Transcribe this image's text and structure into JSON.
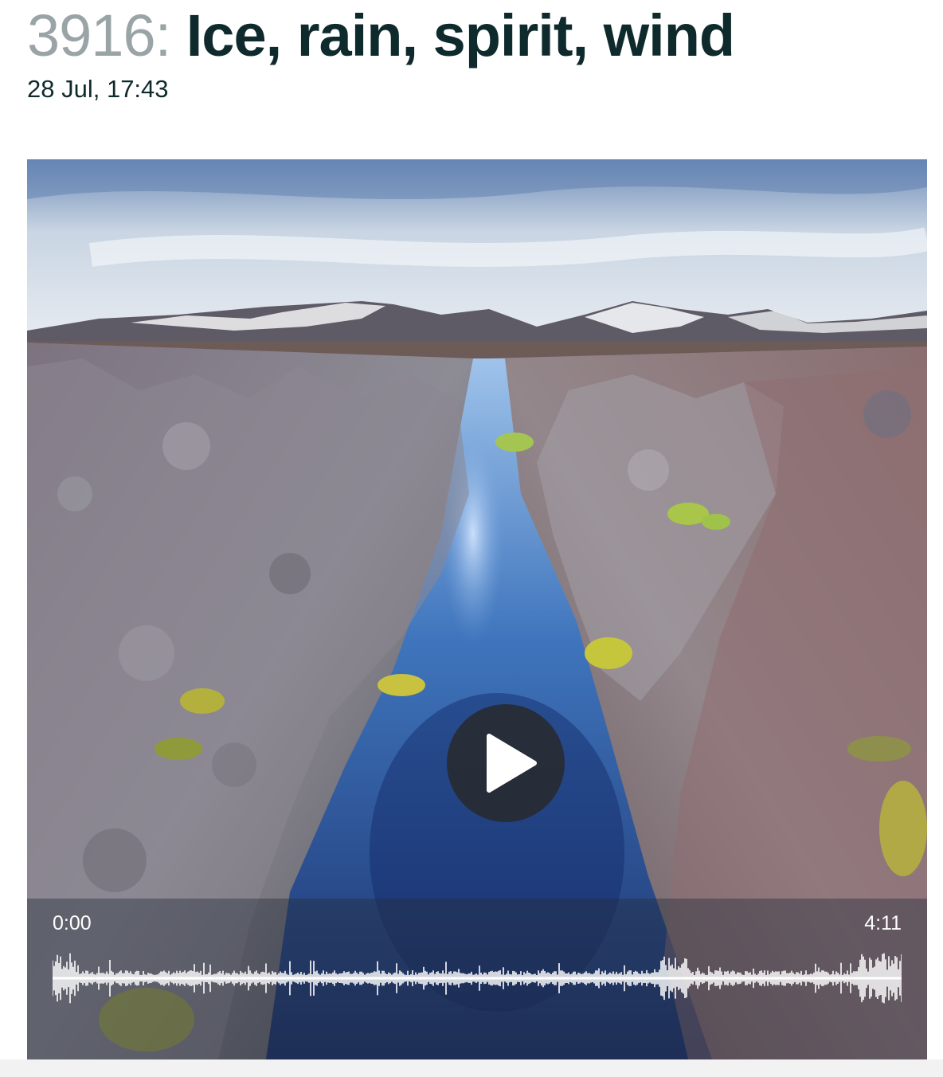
{
  "episode": {
    "number": "3916:",
    "title": "Ice, rain, spirit, wind",
    "date": "28 Jul, 17:43"
  },
  "player": {
    "elapsed": "0:00",
    "duration": "4:11",
    "progress": 0,
    "artwork_subject": "rocky fissure with clear blue water under snowy mountains",
    "play_icon": "play-icon"
  },
  "colors": {
    "title": "#0f2a2c",
    "number": "#9aa4a6",
    "scrubber_overlay": "rgba(35,45,60,0.42)",
    "waveform": "#ffffff"
  }
}
